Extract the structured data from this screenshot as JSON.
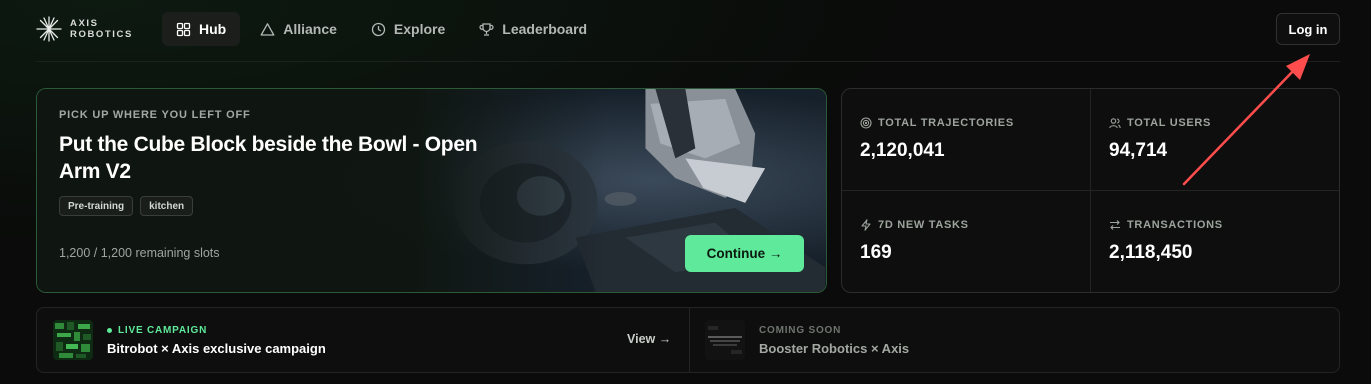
{
  "brand": {
    "line1": "AXIS",
    "line2": "ROBOTICS"
  },
  "nav": [
    {
      "label": "Hub",
      "icon": "grid-icon",
      "active": true
    },
    {
      "label": "Alliance",
      "icon": "triangle-icon"
    },
    {
      "label": "Explore",
      "icon": "clock-icon"
    },
    {
      "label": "Leaderboard",
      "icon": "trophy-icon"
    }
  ],
  "header": {
    "login_label": "Log in"
  },
  "hero": {
    "eyebrow": "PICK UP WHERE YOU LEFT OFF",
    "title": "Put the Cube Block beside the Bowl - Open Arm V2",
    "tags": [
      "Pre-training",
      "kitchen"
    ],
    "slots": "1,200 / 1,200 remaining slots",
    "continue_label": "Continue →"
  },
  "stats": [
    {
      "label": "TOTAL TRAJECTORIES",
      "value": "2,120,041",
      "icon": "target-icon"
    },
    {
      "label": "TOTAL USERS",
      "value": "94,714",
      "icon": "users-icon"
    },
    {
      "label": "7D NEW TASKS",
      "value": "169",
      "icon": "bolt-icon"
    },
    {
      "label": "TRANSACTIONS",
      "value": "2,118,450",
      "icon": "swap-icon"
    }
  ],
  "campaigns": [
    {
      "status": "LIVE CAMPAIGN",
      "title": "Bitrobot × Axis exclusive campaign",
      "action": "View →"
    },
    {
      "status": "COMING SOON",
      "title": "Booster Robotics × Axis"
    }
  ],
  "colors": {
    "accent": "#5fe99a",
    "annotation": "#ff4d4d",
    "background": "#0a0b0a",
    "border": "#232523"
  }
}
